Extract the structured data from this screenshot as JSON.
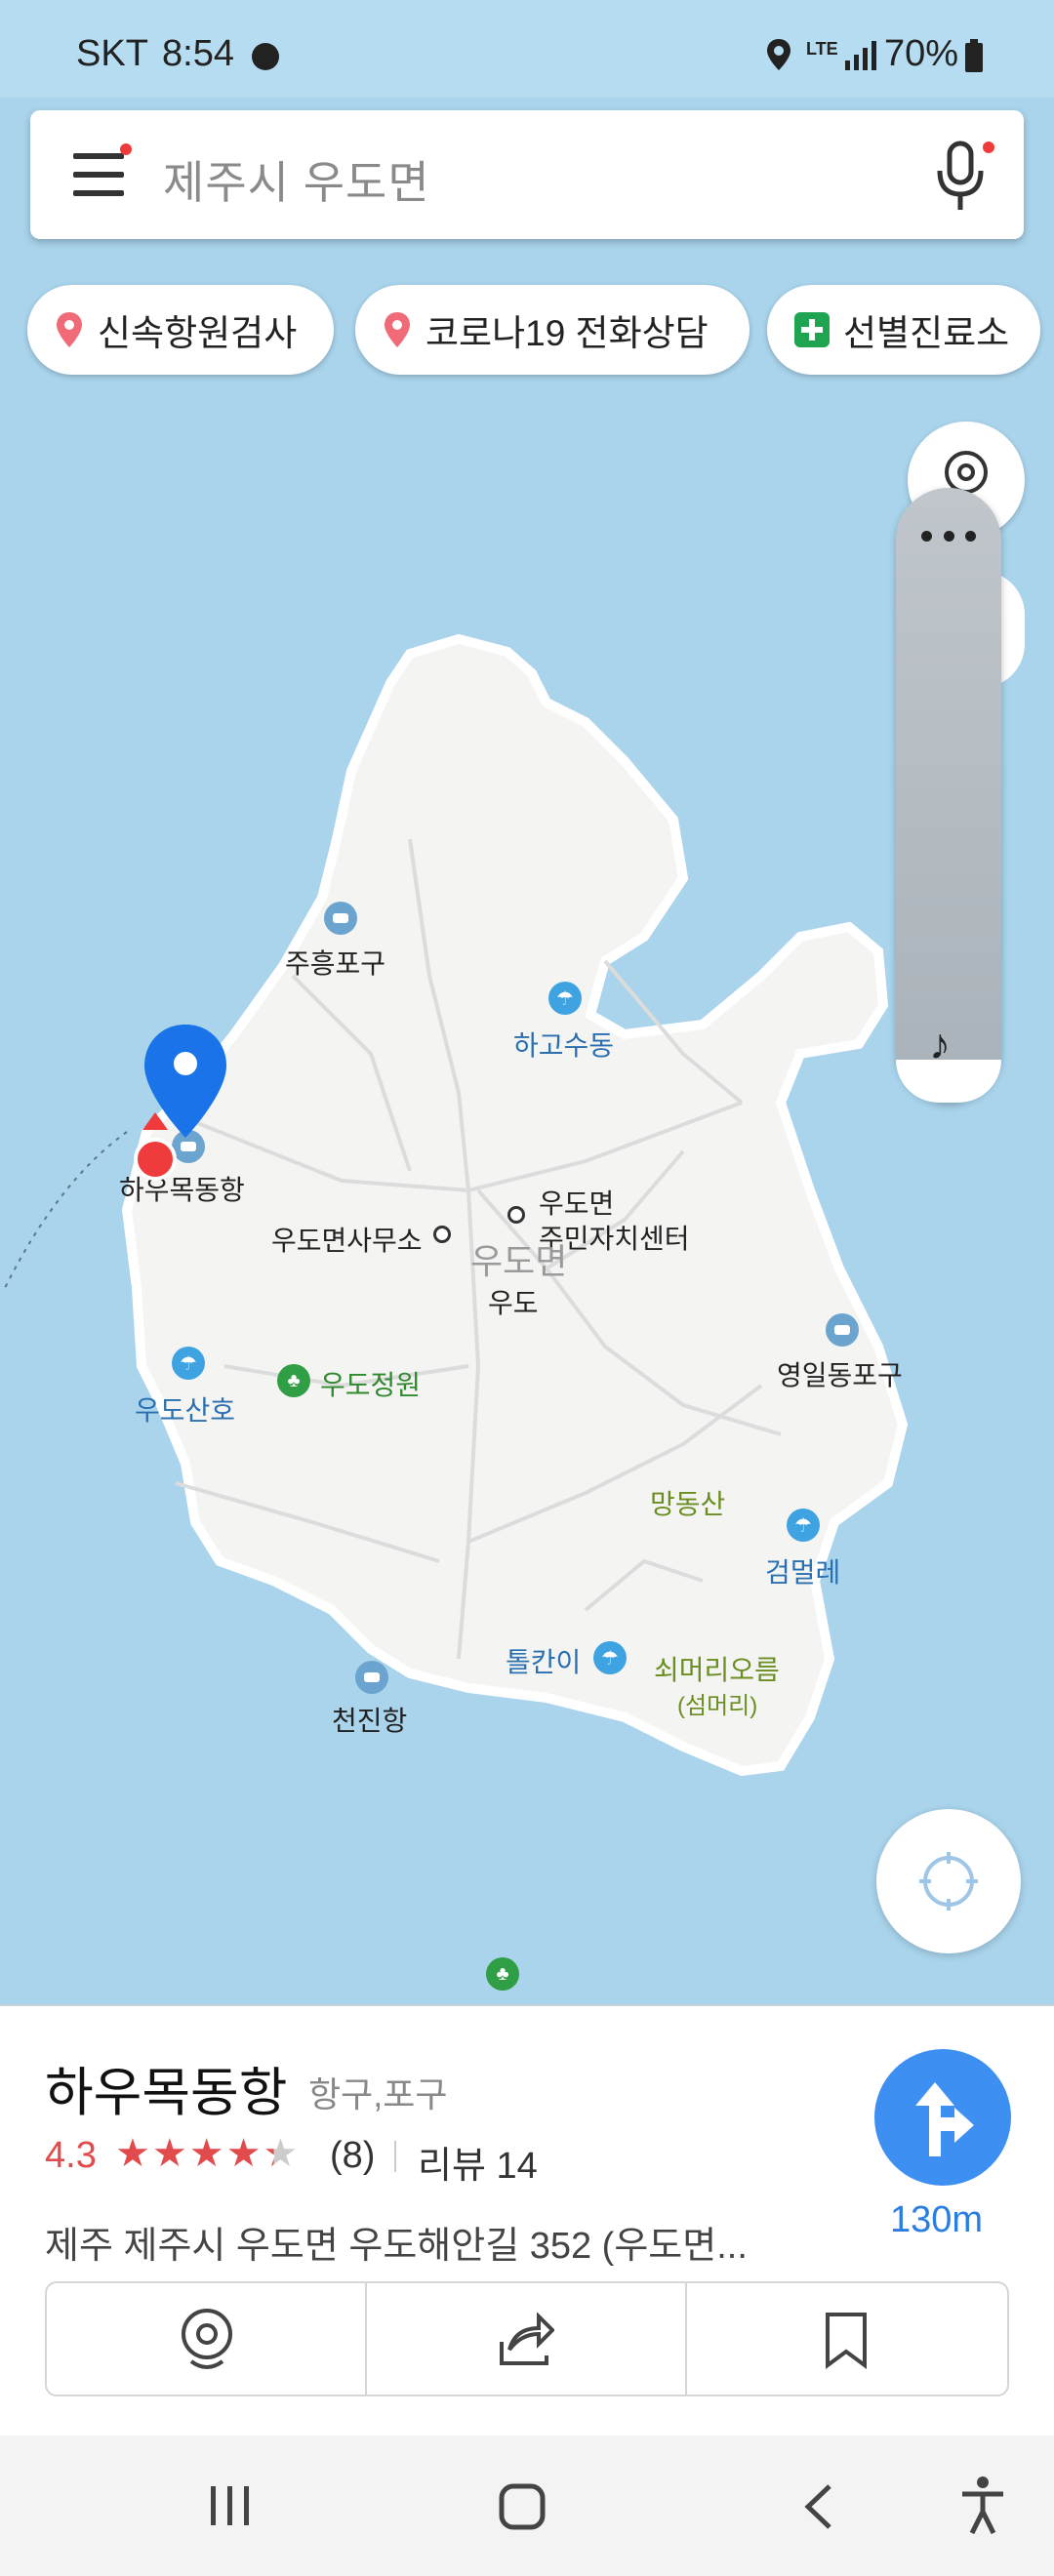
{
  "status_bar": {
    "carrier": "SKT",
    "time": "8:54",
    "network": "LTE",
    "battery": "70%"
  },
  "search": {
    "placeholder": "제주시 우도면"
  },
  "chips": [
    {
      "label": "신속항원검사",
      "icon": "pin-icon"
    },
    {
      "label": "코로나19 전화상담",
      "icon": "pin-icon"
    },
    {
      "label": "선별진료소",
      "icon": "plus-cross-icon"
    }
  ],
  "map": {
    "labels": {
      "juheung": "주흥포구",
      "hagosudong": "하고수동",
      "haumokdong": "하우목동항",
      "myeonsamuso": "우도면사무소",
      "jumin1": "우도면",
      "jumin2": "주민자치센터",
      "udomyeon": "우도면",
      "udo": "우도",
      "udojeongwon": "우도정원",
      "udosanho": "우도산호",
      "yeongil": "영일동포구",
      "mangdongsan": "망동산",
      "geommeolle": "검멀레",
      "tolkani": "톨칸이",
      "soemeori": "쇠머리오름",
      "seommeori": "(섬머리)",
      "cheonjin": "천진항"
    }
  },
  "place": {
    "name": "하우목동항",
    "category": "항구,포구",
    "rating": "4.3",
    "stars": 4.3,
    "rating_count": "(8)",
    "review": "리뷰 14",
    "address": "제주 제주시 우도면 우도해안길 352 (우도면...",
    "distance": "130m"
  },
  "colors": {
    "accent": "#3d8ff2",
    "rating": "#e24b4b",
    "sea": "#a9d4ec",
    "land": "#f4f4f2"
  }
}
